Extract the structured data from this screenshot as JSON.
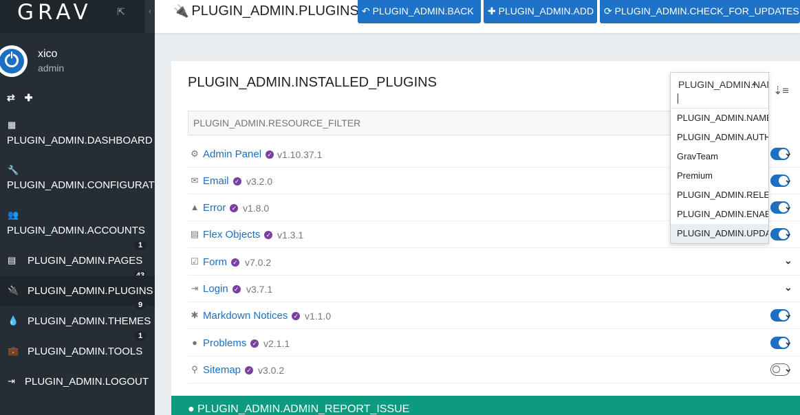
{
  "brand": {
    "logo": "GRAV",
    "external_icon": "external-link-icon",
    "collapse_icon": "chevron-left-icon"
  },
  "user": {
    "name": "xico",
    "role": "admin",
    "avatar_icon": "power-icon"
  },
  "quick_actions": {
    "refresh_icon": "refresh-icon",
    "add_icon": "plus-icon"
  },
  "sidebar": {
    "items": [
      {
        "label": "PLUGIN_ADMIN.DASHBOARD",
        "icon": "grid-icon"
      },
      {
        "label": "PLUGIN_ADMIN.CONFIGURATION",
        "icon": "wrench-icon"
      },
      {
        "label": "PLUGIN_ADMIN.ACCOUNTS",
        "icon": "users-icon",
        "badge": "1"
      },
      {
        "label": "PLUGIN_ADMIN.PAGES",
        "icon": "file-icon",
        "badge": "43"
      },
      {
        "label": "PLUGIN_ADMIN.PLUGINS",
        "icon": "plug-icon",
        "badge": "9"
      },
      {
        "label": "PLUGIN_ADMIN.THEMES",
        "icon": "tint-icon",
        "badge": "1"
      },
      {
        "label": "PLUGIN_ADMIN.TOOLS",
        "icon": "briefcase-icon"
      },
      {
        "label": "PLUGIN_ADMIN.LOGOUT",
        "icon": "sign-out-icon"
      }
    ]
  },
  "header": {
    "title": "PLUGIN_ADMIN.PLUGINS",
    "back_label": "PLUGIN_ADMIN.BACK",
    "add_label": "PLUGIN_ADMIN.ADD",
    "check_updates_label": "PLUGIN_ADMIN.CHECK_FOR_UPDATES"
  },
  "main": {
    "title": "PLUGIN_ADMIN.INSTALLED_PLUGINS",
    "filter_placeholder": "PLUGIN_ADMIN.RESOURCE_FILTER",
    "sort_icon": "sort-amount-icon"
  },
  "plugins": [
    {
      "name": "Admin Panel",
      "version": "v1.10.37.1",
      "icon": "admin-panel-icon",
      "toggle": "on"
    },
    {
      "name": "Email",
      "version": "v3.2.0",
      "icon": "envelope-icon",
      "toggle": "on"
    },
    {
      "name": "Error",
      "version": "v1.8.0",
      "icon": "warning-icon",
      "toggle": "on"
    },
    {
      "name": "Flex Objects",
      "version": "v1.3.1",
      "icon": "list-alt-icon",
      "toggle": "on"
    },
    {
      "name": "Form",
      "version": "v7.0.2",
      "icon": "check-square-icon",
      "toggle": "none"
    },
    {
      "name": "Login",
      "version": "v3.7.1",
      "icon": "sign-in-icon",
      "toggle": "none"
    },
    {
      "name": "Markdown Notices",
      "version": "v1.1.0",
      "icon": "asterisk-icon",
      "toggle": "on"
    },
    {
      "name": "Problems",
      "version": "v2.1.1",
      "icon": "exclamation-circle-icon",
      "toggle": "on"
    },
    {
      "name": "Sitemap",
      "version": "v3.0.2",
      "icon": "map-marker-icon",
      "toggle": "off"
    }
  ],
  "report_issue": {
    "label": "PLUGIN_ADMIN.ADMIN_REPORT_ISSUE",
    "icon": "github-icon"
  },
  "sort_dropdown": {
    "selected": "PLUGIN_ADMIN.NAME",
    "options": [
      "PLUGIN_ADMIN.NAME",
      "PLUGIN_ADMIN.AUTHOR",
      "GravTeam",
      "Premium",
      "PLUGIN_ADMIN.RELEASE_DATE",
      "PLUGIN_ADMIN.ENABLED",
      "PLUGIN_ADMIN.UPDATES"
    ]
  },
  "colors": {
    "accent": "#1d6fc2",
    "sidebar_bg": "#262e35",
    "report_bg": "#0c9b7f",
    "verified_badge": "#7b3fa0"
  }
}
